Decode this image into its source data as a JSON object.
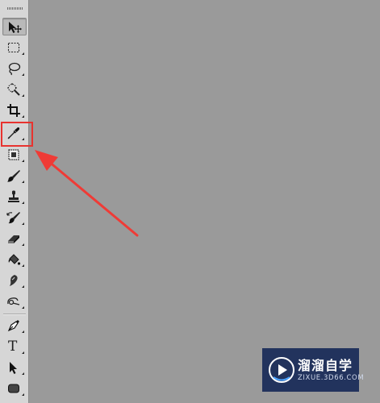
{
  "toolbar": {
    "tools": [
      {
        "name": "move-tool",
        "icon": "move-arrow-icon",
        "active": true
      },
      {
        "name": "marquee-tool",
        "icon": "rectangular-marquee-icon"
      },
      {
        "name": "lasso-tool",
        "icon": "lasso-icon"
      },
      {
        "name": "quick-selection-tool",
        "icon": "magic-wand-icon"
      },
      {
        "name": "crop-tool",
        "icon": "crop-icon"
      },
      {
        "name": "eyedropper-tool",
        "icon": "eyedropper-icon",
        "highlighted": true
      },
      {
        "name": "healing-tool",
        "icon": "healing-patch-icon"
      },
      {
        "name": "brush-tool",
        "icon": "brush-icon"
      },
      {
        "name": "clone-stamp-tool",
        "icon": "stamp-icon"
      },
      {
        "name": "history-brush-tool",
        "icon": "history-brush-icon"
      },
      {
        "name": "eraser-tool",
        "icon": "eraser-icon"
      },
      {
        "name": "paint-bucket-tool",
        "icon": "paint-bucket-icon"
      },
      {
        "name": "blur-tool",
        "icon": "blur-icon"
      },
      {
        "name": "dodge-tool",
        "icon": "dodge-icon"
      },
      {
        "name": "pen-tool",
        "icon": "pen-icon"
      },
      {
        "name": "type-tool",
        "icon": "type-icon",
        "glyph": "T"
      },
      {
        "name": "path-selection-tool",
        "icon": "path-selection-icon"
      },
      {
        "name": "shape-tool",
        "icon": "rounded-rectangle-icon"
      }
    ]
  },
  "annotation": {
    "highlight_color": "#e8332f",
    "arrow_color": "#ef3b36"
  },
  "colors": {
    "canvas": "#9a9a9a",
    "toolbar": "#d6d6d6",
    "watermark_bg": "#182a58"
  },
  "watermark": {
    "name": "溜溜自学",
    "url": "ZIXUE.3D66.COM"
  }
}
